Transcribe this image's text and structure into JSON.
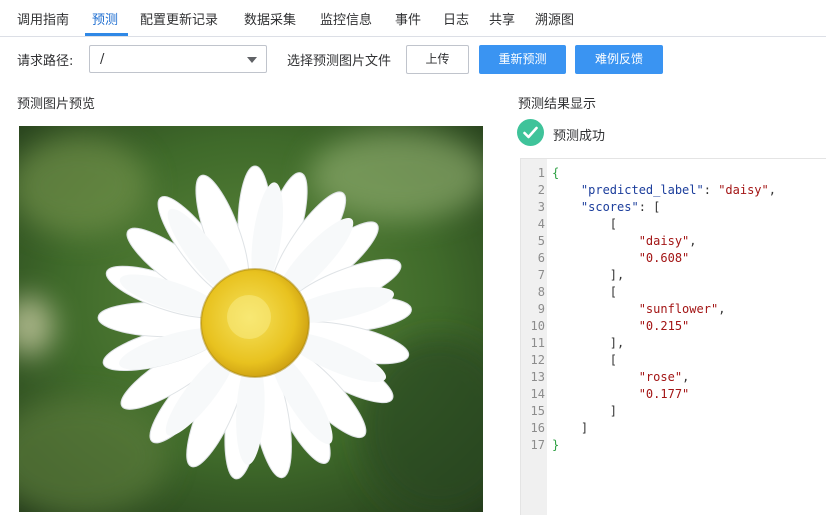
{
  "tabs": [
    {
      "label": "调用指南"
    },
    {
      "label": "预测",
      "active": true
    },
    {
      "label": "配置更新记录"
    },
    {
      "label": "数据采集"
    },
    {
      "label": "监控信息"
    },
    {
      "label": "事件"
    },
    {
      "label": "日志"
    },
    {
      "label": "共享"
    },
    {
      "label": "溯源图"
    }
  ],
  "request": {
    "path_label": "请求路径:",
    "path_value": "/",
    "file_label": "选择预测图片文件",
    "upload_button": "上传",
    "repredict_button": "重新预测",
    "feedback_button": "难例反馈"
  },
  "preview": {
    "title": "预测图片预览",
    "image_subject": "white daisy flower with yellow center on blurred green background"
  },
  "result": {
    "title": "预测结果显示",
    "status": "预测成功",
    "status_color": "#3fc39a",
    "json_lines": [
      "{",
      "    \"predicted_label\": \"daisy\",",
      "    \"scores\": [",
      "        [",
      "            \"daisy\",",
      "            \"0.608\"",
      "        ],",
      "        [",
      "            \"sunflower\",",
      "            \"0.215\"",
      "        ],",
      "        [",
      "            \"rose\",",
      "            \"0.177\"",
      "        ]",
      "    ]",
      "}"
    ]
  },
  "colors": {
    "primary_button": "#3a94f2",
    "active_tab": "#1f6fd1",
    "json_key": "#1c3e9c",
    "json_string": "#a31515",
    "json_brace": "#2ea043"
  }
}
